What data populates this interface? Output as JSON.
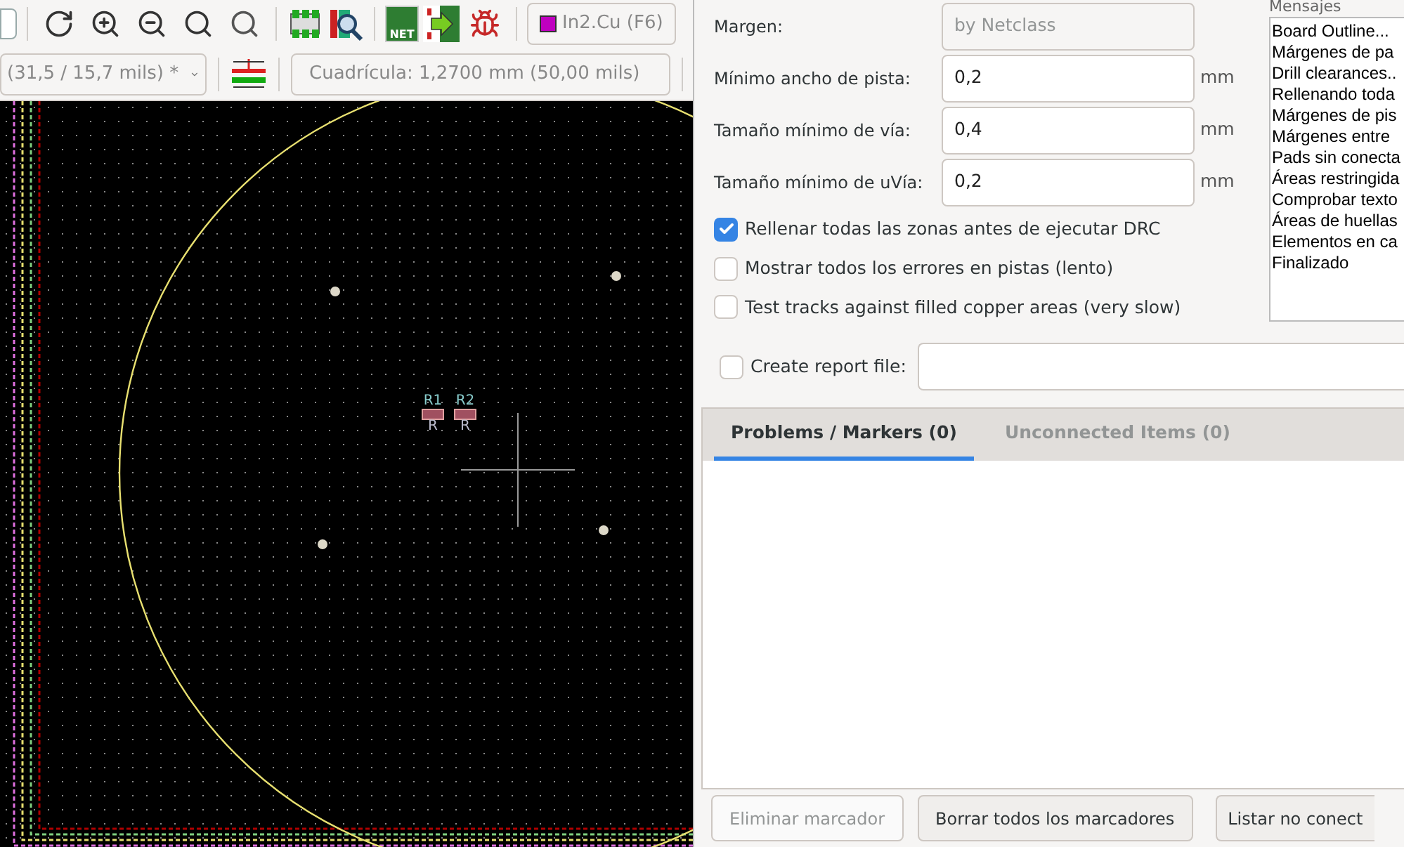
{
  "toolbar": {
    "layer": "In2.Cu (F6)",
    "net_label": "NET"
  },
  "toolbar2": {
    "track_dropdown": "(31,5 / 15,7 mils) *",
    "grid_dropdown": "Cuadrícula: 1,2700 mm (50,00 mils)"
  },
  "canvas": {
    "footprints": [
      {
        "reference": "R1",
        "value": "R"
      },
      {
        "reference": "R2",
        "value": "R"
      }
    ]
  },
  "drc": {
    "fields": [
      {
        "label": "Margen:",
        "value": "by Netclass",
        "disabled": true
      },
      {
        "label": "Mínimo ancho de pista:",
        "value": "0,2",
        "unit": "mm",
        "disabled": false
      },
      {
        "label": "Tamaño mínimo de vía:",
        "value": "0,4",
        "unit": "mm",
        "disabled": false
      },
      {
        "label": "Tamaño mínimo de uVía:",
        "value": "0,2",
        "unit": "mm",
        "disabled": false
      }
    ],
    "options": [
      {
        "label": "Rellenar todas las zonas antes de ejecutar DRC",
        "checked": true
      },
      {
        "label": "Mostrar todos los errores en pistas (lento)",
        "checked": false
      },
      {
        "label": "Test tracks against filled copper areas (very slow)",
        "checked": false
      }
    ],
    "report": {
      "label": "Create report file:",
      "checked": false
    },
    "tabs": [
      {
        "label": "Problems / Markers (0)",
        "selected": true
      },
      {
        "label": "Unconnected Items (0)",
        "selected": false
      }
    ],
    "messages": {
      "title": "Mensajes",
      "lines": [
        "Board Outline...",
        "Márgenes de pa",
        "Drill clearances..",
        "Rellenando toda",
        "Márgenes de pis",
        "Márgenes entre",
        "Pads sin conecta",
        "Áreas restringida",
        "Comprobar texto",
        "Áreas de huellas",
        "Elementos en ca",
        "Finalizado"
      ]
    },
    "buttons": [
      {
        "label": "Eliminar marcador",
        "disabled": true
      },
      {
        "label": "Borrar todos los marcadores",
        "disabled": false
      },
      {
        "label": "Listar no conect",
        "disabled": false
      }
    ]
  }
}
